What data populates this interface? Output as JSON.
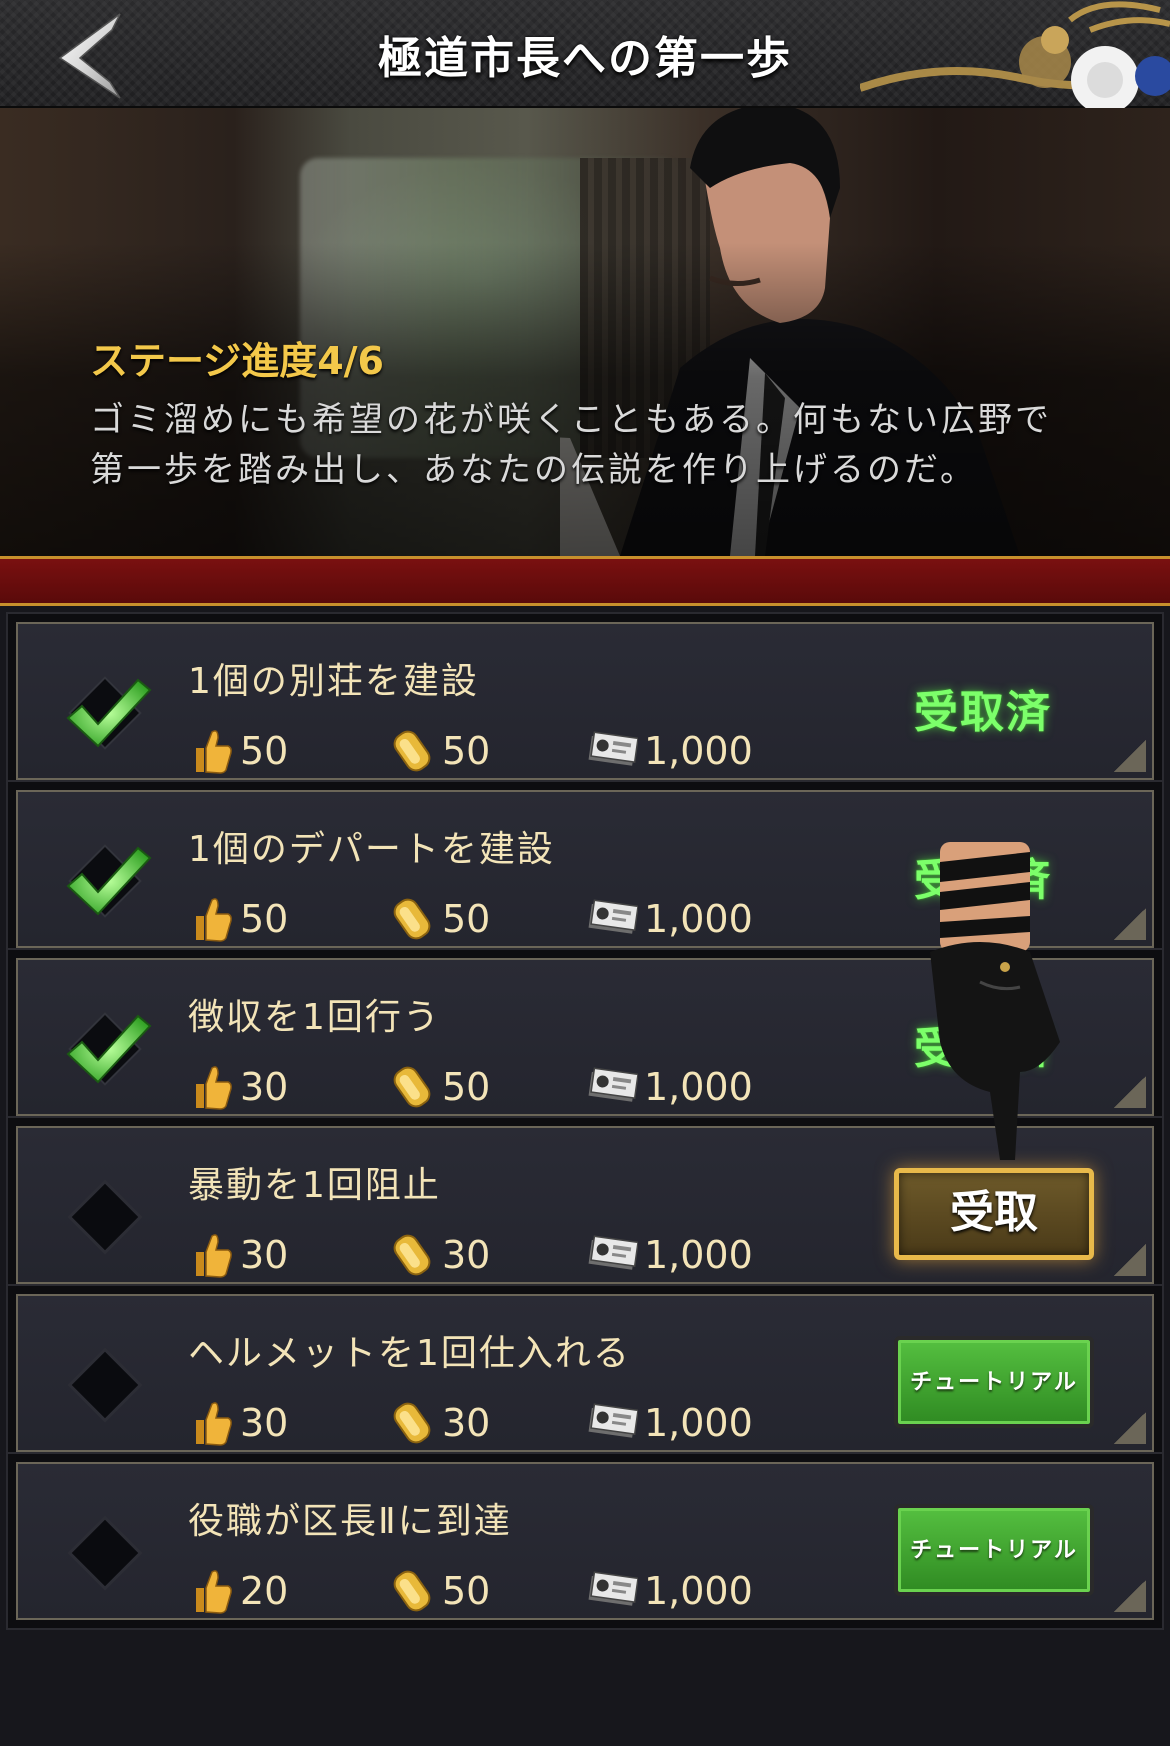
{
  "header": {
    "title": "極道市長への第一歩",
    "back_icon": "chevron-left-icon"
  },
  "banner": {
    "stage_progress": "ステージ進度4/6",
    "description": "ゴミ溜めにも希望の花が咲くこともある。何もない広野で第一歩を踏み出し、あなたの伝説を作り上げるのだ。"
  },
  "colors": {
    "claimed_green": "#7cff6a",
    "gold_accent": "#e8b94a",
    "tutorial_green": "#2f8a22",
    "banner_red": "#7a1010"
  },
  "quests": [
    {
      "title": "1個の別荘を建設",
      "done": true,
      "rewards": {
        "thumbs": "50",
        "gold": "50",
        "cash": "1,000"
      },
      "action": "受取済",
      "action_type": "claimed"
    },
    {
      "title": "1個のデパートを建設",
      "done": true,
      "rewards": {
        "thumbs": "50",
        "gold": "50",
        "cash": "1,000"
      },
      "action": "受取済",
      "action_type": "claimed"
    },
    {
      "title": "徴収を1回行う",
      "done": true,
      "rewards": {
        "thumbs": "30",
        "gold": "50",
        "cash": "1,000"
      },
      "action": "受取済",
      "action_type": "claimed"
    },
    {
      "title": "暴動を1回阻止",
      "done": false,
      "rewards": {
        "thumbs": "30",
        "gold": "30",
        "cash": "1,000"
      },
      "action": "受取",
      "action_type": "claim"
    },
    {
      "title": "ヘルメットを1回仕入れる",
      "done": false,
      "rewards": {
        "thumbs": "30",
        "gold": "30",
        "cash": "1,000"
      },
      "action": "チュートリアル",
      "action_type": "tutorial"
    },
    {
      "title": "役職が区長Ⅱに到達",
      "done": false,
      "rewards": {
        "thumbs": "20",
        "gold": "50",
        "cash": "1,000"
      },
      "action": "チュートリアル",
      "action_type": "tutorial"
    }
  ]
}
